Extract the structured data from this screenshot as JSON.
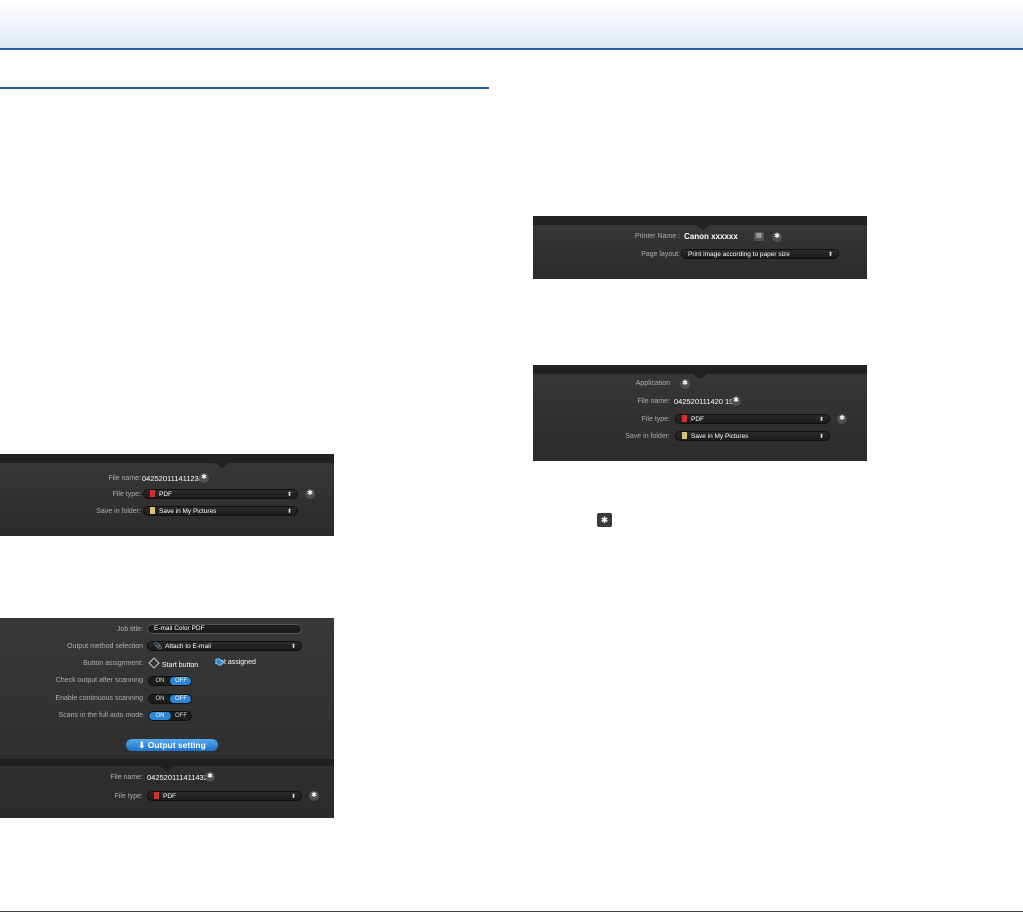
{
  "panel_a": {
    "file_name_label": "File name:",
    "file_name_value": "042520111411238",
    "file_type_label": "File type:",
    "file_type_value": "PDF",
    "save_in_label": "Save in folder:",
    "save_in_value": "Save in My Pictures"
  },
  "panel_b": {
    "job_title_label": "Job title:",
    "job_title_value": "E-mail Color PDF",
    "output_method_label": "Output method selection",
    "output_method_value": "Attach to E-mail",
    "button_assignment_label": "Button assignment:",
    "start_button_label": "Start button",
    "not_assigned_label": "Not assigned",
    "check_output_label": "Check output after scanning",
    "continuous_label": "Enable continuous scanning",
    "full_auto_label": "Scans in the full auto mode",
    "on_label": "ON",
    "off_label": "OFF",
    "output_setting_label": "Output setting",
    "file_name_label": "File name:",
    "file_name_value": "042520111411432",
    "file_type_label": "File type:",
    "file_type_value": "PDF"
  },
  "panel_c": {
    "printer_name_label": "Printer Name :",
    "printer_name_value": "Canon xxxxxx",
    "page_layout_label": "Page layout:",
    "page_layout_value": "Print image according to paper size"
  },
  "panel_d": {
    "application_label": "Application",
    "file_name_label": "File name:",
    "file_name_value": "042520111420 19",
    "file_type_label": "File type:",
    "file_type_value": "PDF",
    "save_in_label": "Save in folder:",
    "save_in_value": "Save in My Pictures"
  },
  "icons": {
    "gear": "gear-icon",
    "arrows": "up-down-arrows-icon",
    "pdf": "pdf-file-icon",
    "folder": "folder-icon",
    "download": "down-arrow-icon"
  }
}
